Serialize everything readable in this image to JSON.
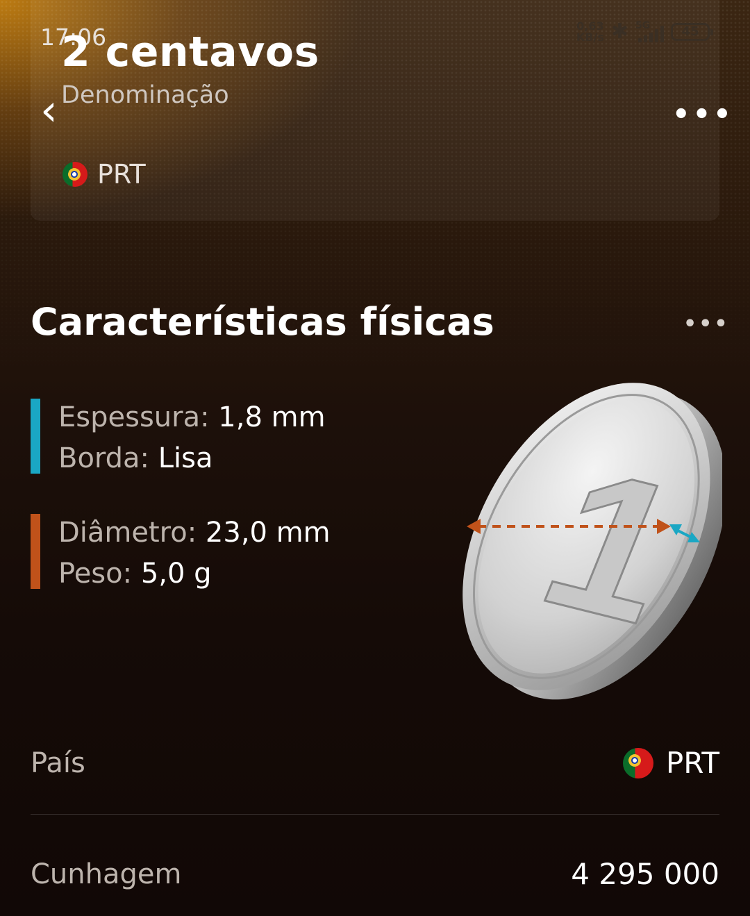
{
  "status_bar": {
    "time": "17:06",
    "net_speed_value": "0,63",
    "net_speed_unit": "KB/s",
    "bluetooth_icon": "bluetooth-icon",
    "network_type": "5G",
    "signal_icon": "signal-bars-icon",
    "battery_level": "45"
  },
  "header": {
    "title": "2 centavos",
    "subtitle": "Denominação",
    "country_code": "PRT",
    "back_icon": "chevron-left-icon",
    "menu_icon": "more-horizontal-icon"
  },
  "physical": {
    "section_title": "Características físicas",
    "menu_icon": "more-horizontal-icon",
    "thickness_label": "Espessura: ",
    "thickness_value": "1,8 mm",
    "edge_label": "Borda: ",
    "edge_value": "Lisa",
    "diameter_label": "Diâmetro: ",
    "diameter_value": "23,0 mm",
    "weight_label": "Peso: ",
    "weight_value": "5,0 g",
    "coin_digit": "1",
    "colors": {
      "thickness_accent": "#1aa7c4",
      "diameter_accent": "#c0521a"
    }
  },
  "details": {
    "country_label": "País",
    "country_value": "PRT",
    "mintage_label": "Cunhagem",
    "mintage_value": "4 295 000"
  }
}
